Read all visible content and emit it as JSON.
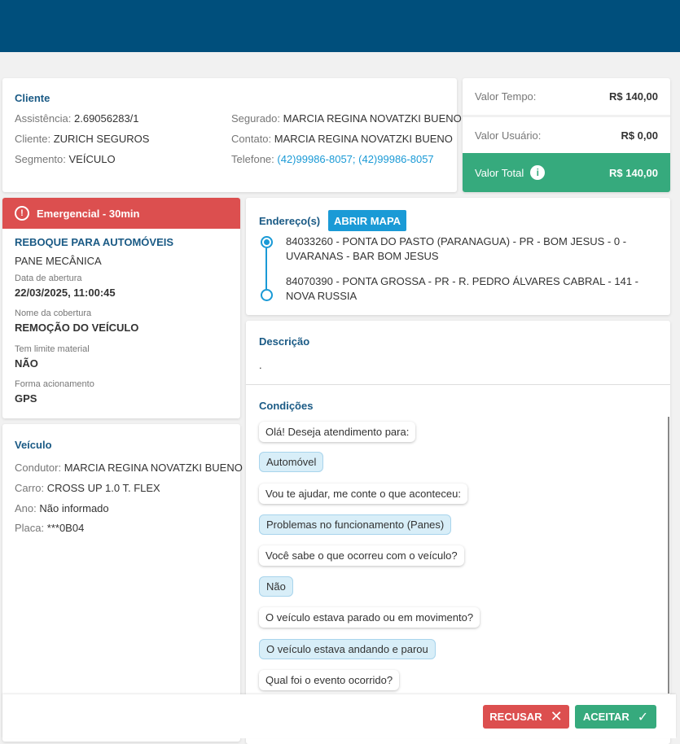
{
  "cliente": {
    "title": "Cliente",
    "assistencia_label": "Assistência:",
    "assistencia": "2.69056283/1",
    "cliente_label": "Cliente:",
    "cliente": "ZURICH SEGUROS",
    "segmento_label": "Segmento:",
    "segmento": "VEÍCULO",
    "segurado_label": "Segurado:",
    "segurado": "MARCIA REGINA NOVATZKI BUENO",
    "contato_label": "Contato:",
    "contato": "MARCIA REGINA NOVATZKI BUENO",
    "telefone_label": "Telefone:",
    "telefone": "(42)99986-8057; (42)99986-8057"
  },
  "valores": {
    "tempo_label": "Valor Tempo:",
    "tempo": "R$ 140,00",
    "usuario_label": "Valor Usuário:",
    "usuario": "R$ 0,00",
    "total_label": "Valor Total",
    "total": "R$ 140,00",
    "total_color": "#36aa7d"
  },
  "servico": {
    "badge": "Emergencial - 30min",
    "badge_color": "#dc4f4f",
    "tipo": "REBOQUE PARA AUTOMÓVEIS",
    "problema": "PANE MECÂNICA",
    "data_label": "Data de abertura",
    "data": "22/03/2025, 11:00:45",
    "cobertura_label": "Nome da cobertura",
    "cobertura": "REMOÇÃO DO VEÍCULO",
    "limite_label": "Tem limite material",
    "limite": "NÃO",
    "forma_label": "Forma acionamento",
    "forma": "GPS"
  },
  "veiculo": {
    "title": "Veículo",
    "condutor_label": "Condutor:",
    "condutor": "MARCIA REGINA NOVATZKI BUENO",
    "carro_label": "Carro:",
    "carro": "CROSS UP 1.0 T. FLEX",
    "ano_label": "Ano:",
    "ano": "Não informado",
    "placa_label": "Placa:",
    "placa": "***0B04"
  },
  "endereco": {
    "title": "Endereço(s)",
    "map_button": "ABRIR MAPA",
    "origem": "84033260 - PONTA DO PASTO (PARANAGUA) - PR - BOM JESUS - 0 - UVARANAS - BAR BOM JESUS",
    "destino": "84070390 - PONTA GROSSA - PR - R. PEDRO ÁLVARES CABRAL - 141 - NOVA RUSSIA"
  },
  "descricao": {
    "title": "Descrição",
    "text": "."
  },
  "condicoes": {
    "title": "Condições",
    "messages": [
      {
        "text": "Olá! Deseja atendimento para:",
        "type": "question"
      },
      {
        "text": "Automóvel",
        "type": "answer"
      },
      {
        "text": "Vou te ajudar, me conte o que aconteceu:",
        "type": "question"
      },
      {
        "text": "Problemas no funcionamento (Panes)",
        "type": "answer"
      },
      {
        "text": "Você sabe o que ocorreu com o veículo?",
        "type": "question"
      },
      {
        "text": "Não",
        "type": "answer"
      },
      {
        "text": "O veículo estava parado ou em movimento?",
        "type": "question"
      },
      {
        "text": "O veículo estava andando e parou",
        "type": "answer"
      },
      {
        "text": "Qual foi o evento ocorrido?",
        "type": "question"
      }
    ]
  },
  "actions": {
    "recusar": "RECUSAR",
    "aceitar": "ACEITAR"
  }
}
